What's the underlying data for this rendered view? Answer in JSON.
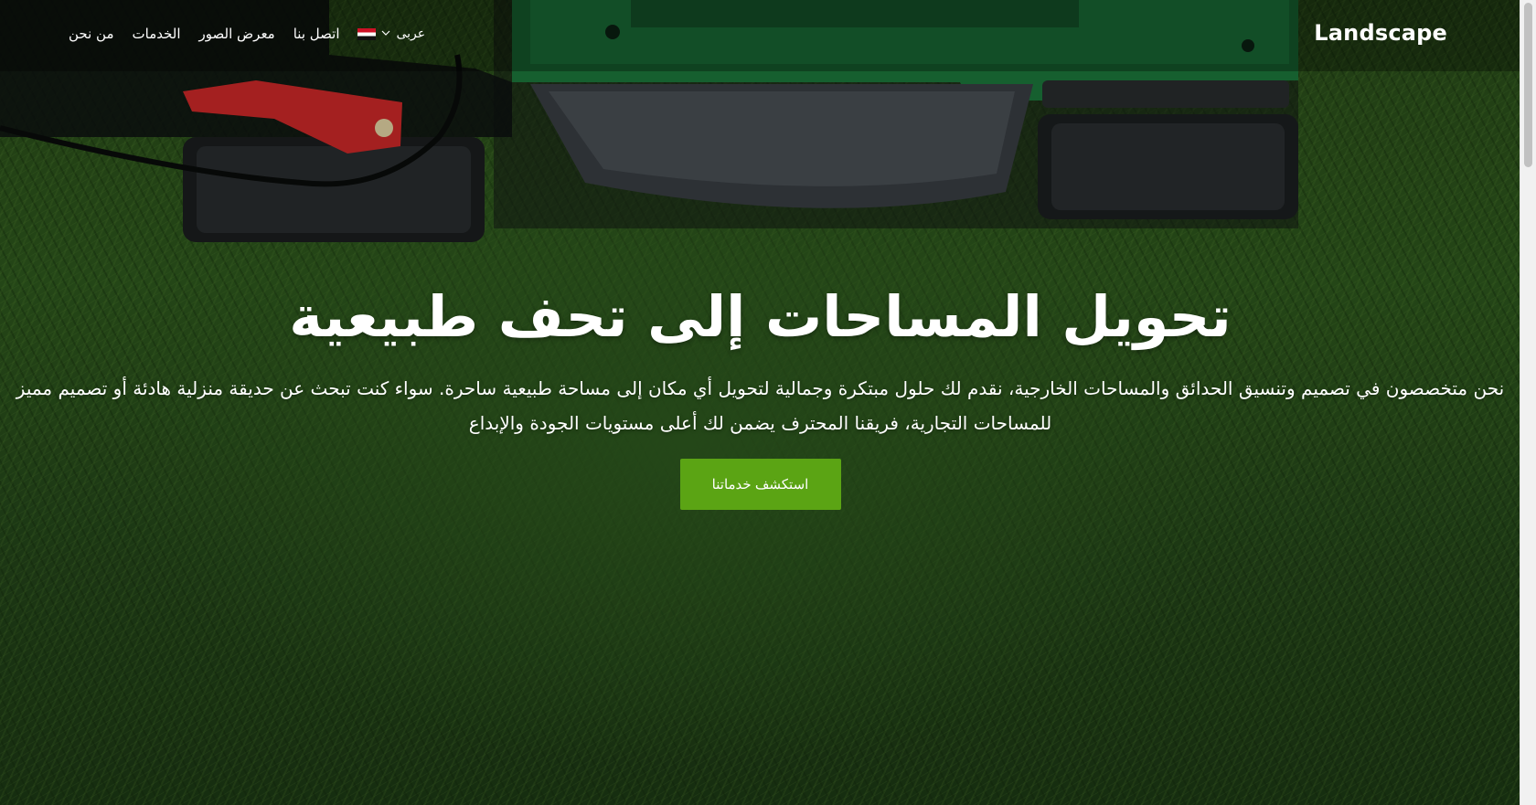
{
  "navbar": {
    "brand": "Landscape",
    "links": [
      "من نحن",
      "الخدمات",
      "معرض الصور",
      "اتصل بنا"
    ],
    "language": {
      "label": "عربى",
      "flag": "egypt-flag-icon"
    }
  },
  "hero": {
    "title": "تحويل المساحات إلى تحف طبيعية",
    "description": "نحن متخصصون في تصميم وتنسيق الحدائق والمساحات الخارجية، نقدم لك حلول مبتكرة وجمالية لتحويل أي مكان إلى مساحة طبيعية ساحرة. سواء كنت تبحث عن حديقة منزلية هادئة أو تصميم مميز للمساحات التجارية، فريقنا المحترف يضمن لك أعلى مستويات الجودة والإبداع",
    "cta_label": "استكشف خدماتنا"
  },
  "colors": {
    "accent": "#5ba414",
    "nav_text": "#ffffff",
    "overlay": "#000000"
  }
}
